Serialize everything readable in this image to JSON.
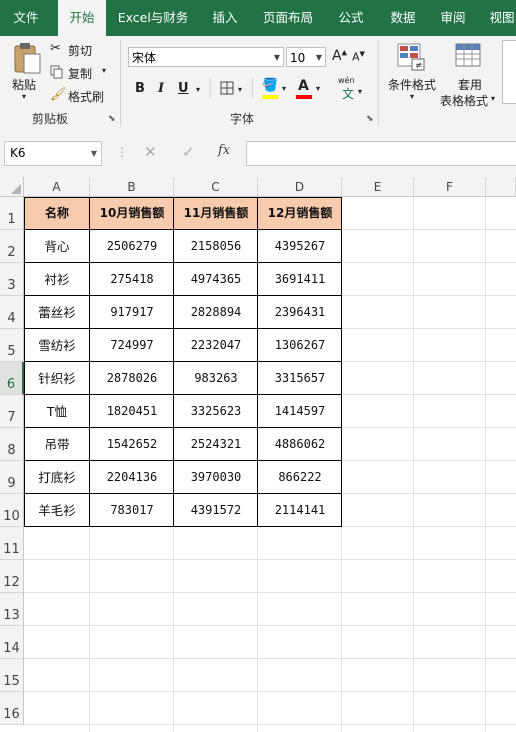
{
  "tabs": [
    "文件",
    "开始",
    "Excel与财务",
    "插入",
    "页面布局",
    "公式",
    "数据",
    "审阅",
    "视图"
  ],
  "active_tab": "开始",
  "clipboard": {
    "paste": "粘贴",
    "cut": "剪切",
    "copy": "复制",
    "format_painter": "格式刷",
    "group": "剪贴板"
  },
  "font": {
    "name": "宋体",
    "size": "10",
    "bold": "B",
    "italic": "I",
    "underline": "U",
    "group": "字体",
    "phonetic": "wén"
  },
  "styles": {
    "conditional": "条件格式",
    "table_format_line1": "套用",
    "table_format_line2": "表格格式"
  },
  "formula_bar": {
    "name_box": "K6",
    "fx": "fx",
    "value": ""
  },
  "columns": [
    "A",
    "B",
    "C",
    "D",
    "E",
    "F"
  ],
  "rows": [
    "1",
    "2",
    "3",
    "4",
    "5",
    "6",
    "7",
    "8",
    "9",
    "10",
    "11",
    "12",
    "13",
    "14",
    "15",
    "16"
  ],
  "selected_row": "6",
  "table": {
    "headers": [
      "名称",
      "10月销售额",
      "11月销售额",
      "12月销售额"
    ],
    "rows": [
      [
        "背心",
        "2506279",
        "2158056",
        "4395267"
      ],
      [
        "衬衫",
        "275418",
        "4974365",
        "3691411"
      ],
      [
        "蕾丝衫",
        "917917",
        "2828894",
        "2396431"
      ],
      [
        "雪纺衫",
        "724997",
        "2232047",
        "1306267"
      ],
      [
        "针织衫",
        "2878026",
        "983263",
        "3315657"
      ],
      [
        "T恤",
        "1820451",
        "3325623",
        "1414597"
      ],
      [
        "吊带",
        "1542652",
        "2524321",
        "4886062"
      ],
      [
        "打底衫",
        "2204136",
        "3970030",
        "866222"
      ],
      [
        "羊毛衫",
        "783017",
        "4391572",
        "2114141"
      ]
    ]
  },
  "colors": {
    "ribbon": "#217346",
    "header_fill": "#f8cbad",
    "font_color": "#ff0000",
    "fill_color": "#ffff00"
  }
}
